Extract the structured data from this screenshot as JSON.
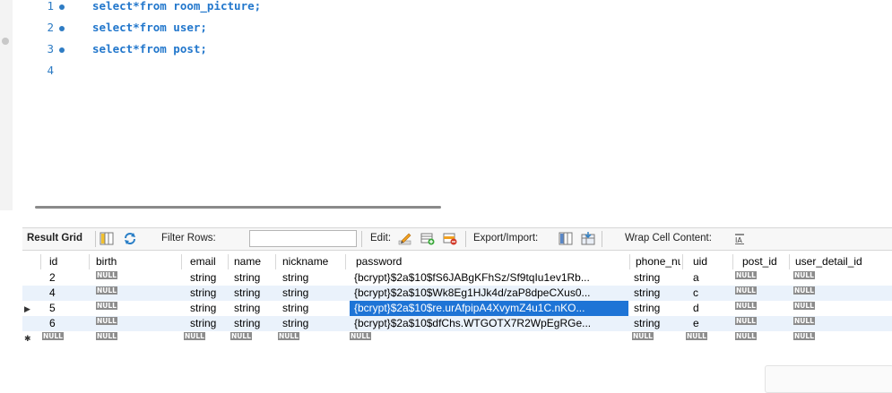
{
  "editor": {
    "lines": [
      {
        "num": "1",
        "code": "select*from room_picture;"
      },
      {
        "num": "2",
        "code": "select*from user;"
      },
      {
        "num": "3",
        "code": "select*from post;"
      },
      {
        "num": "4",
        "code": ""
      }
    ]
  },
  "toolbar": {
    "result_grid": "Result Grid",
    "filter_rows": "Filter Rows:",
    "filter_value": "",
    "edit": "Edit:",
    "export_import": "Export/Import:",
    "wrap_cell": "Wrap Cell Content:"
  },
  "grid": {
    "headers": [
      "id",
      "birth",
      "email",
      "name",
      "nickname",
      "password",
      "phone_nu",
      "uid",
      "post_id",
      "user_detail_id"
    ],
    "null_label": "NULL",
    "rows": [
      {
        "id": "2",
        "email": "string",
        "name": "string",
        "nickname": "string",
        "password": "{bcrypt}$2a$10$fS6JABgKFhSz/Sf9tqIu1ev1Rb...",
        "phone": "string",
        "uid": "a"
      },
      {
        "id": "4",
        "email": "string",
        "name": "string",
        "nickname": "string",
        "password": "{bcrypt}$2a$10$Wk8Eg1HJk4d/zaP8dpeCXus0...",
        "phone": "string",
        "uid": "c"
      },
      {
        "id": "5",
        "email": "string",
        "name": "string",
        "nickname": "string",
        "password": "{bcrypt}$2a$10$re.urAfpipA4XvymZ4u1C.nKO...",
        "phone": "string",
        "uid": "d"
      },
      {
        "id": "6",
        "email": "string",
        "name": "string",
        "nickname": "string",
        "password": "{bcrypt}$2a$10$dfChs.WTGOTX7R2WpEgRGe...",
        "phone": "string",
        "uid": "e"
      }
    ]
  }
}
